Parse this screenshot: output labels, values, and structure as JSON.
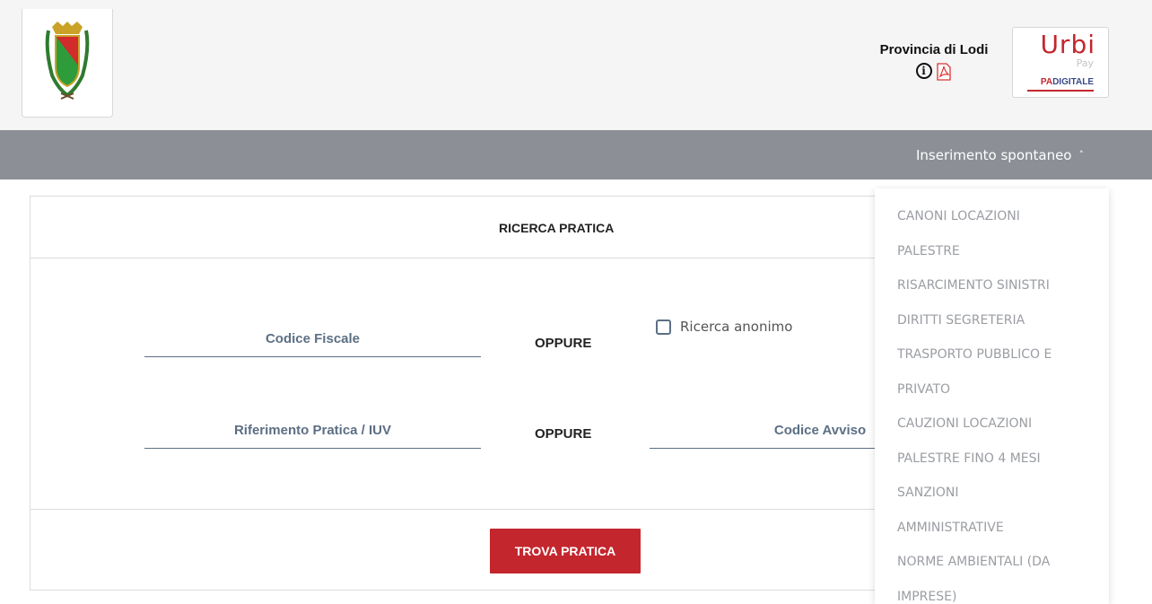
{
  "header": {
    "province_name": "Provincia di Lodi",
    "info_icon": "info-circle-icon",
    "pdf_icon": "pdf-icon",
    "brand": {
      "name": "Urbi",
      "pay": "Pay",
      "pa": "PA",
      "digitale": "DIGITALE"
    }
  },
  "nav": {
    "menu_label": "Inserimento spontaneo",
    "menu_icon": "chevron-up-icon",
    "dropdown_items": [
      "CANONI LOCAZIONI",
      "PALESTRE",
      "RISARCIMENTO SINISTRI",
      "DIRITTI SEGRETERIA",
      "TRASPORTO PUBBLICO E",
      "PRIVATO",
      "CAUZIONI LOCAZIONI",
      "PALESTRE FINO 4 MESI",
      "SANZIONI",
      "AMMINISTRATIVE",
      "NORME AMBIENTALI (DA",
      "IMPRESE)"
    ]
  },
  "search": {
    "title": "RICERCA PRATICA",
    "codice_fiscale_label": "Codice Fiscale",
    "oppure_1": "OPPURE",
    "anonimo_label": "Ricerca anonimo",
    "riferimento_label": "Riferimento Pratica / IUV",
    "oppure_2": "OPPURE",
    "codice_avviso_label": "Codice Avviso",
    "button_label": "TROVA PRATICA"
  },
  "colors": {
    "accent": "#c4262e",
    "nav_bg": "#8c9096",
    "field_label": "#5c6f84"
  }
}
